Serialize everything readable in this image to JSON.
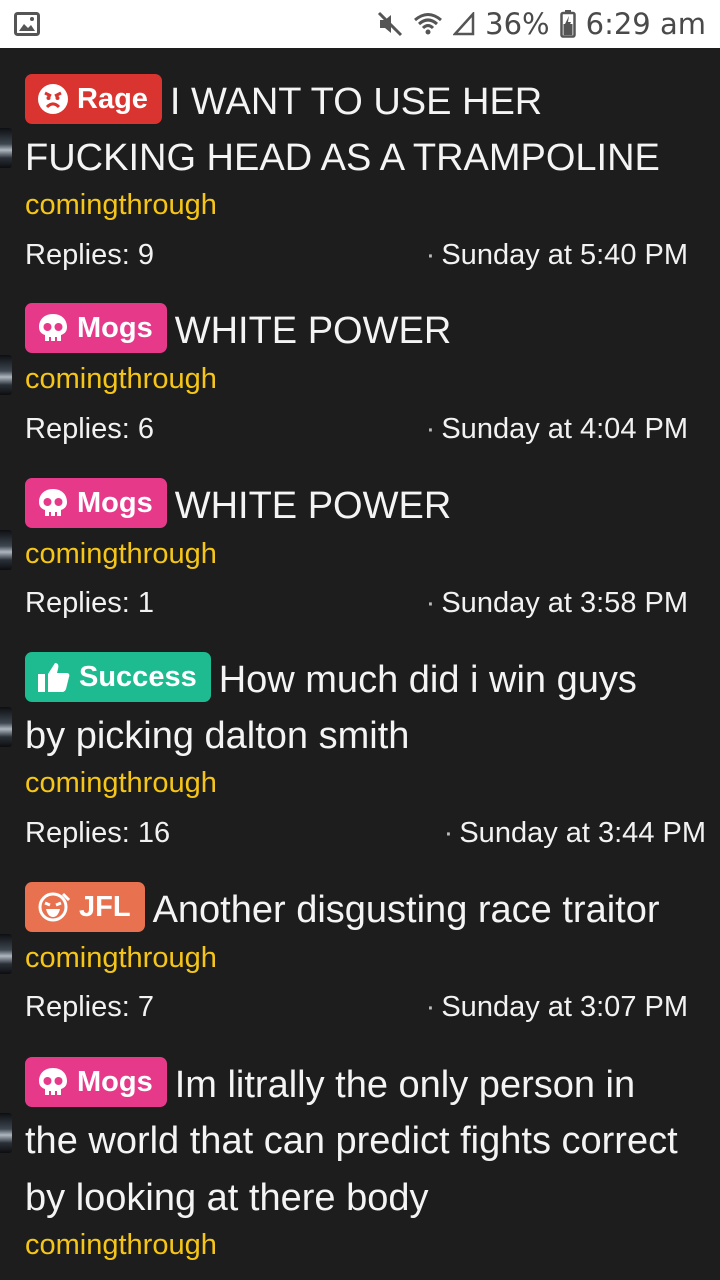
{
  "statusbar": {
    "battery": "36%",
    "time": "6:29 am"
  },
  "colors": {
    "background": "#1d1d1d",
    "author": "#f5c518",
    "rage": "#d9342f",
    "mogs": "#e6398a",
    "success": "#1dbb8f",
    "jfl": "#e8714f"
  },
  "threads": [
    {
      "prefix": "Rage",
      "prefix_icon": "angry-face-icon",
      "title_lines": [
        "I WANT TO USE HER",
        "FUCKING HEAD AS A TRAMPOLINE"
      ],
      "author": "comingthrough",
      "replies": "Replies: 9",
      "date": "Sunday at 5:40 PM"
    },
    {
      "prefix": "Mogs",
      "prefix_icon": "skull-icon",
      "title_lines": [
        "WHITE POWER"
      ],
      "author": "comingthrough",
      "replies": "Replies: 6",
      "date": "Sunday at 4:04 PM"
    },
    {
      "prefix": "Mogs",
      "prefix_icon": "skull-icon",
      "title_lines": [
        "WHITE POWER"
      ],
      "author": "comingthrough",
      "replies": "Replies: 1",
      "date": "Sunday at 3:58 PM"
    },
    {
      "prefix": "Success",
      "prefix_icon": "thumbs-up-icon",
      "title_lines": [
        "How much did i win guys",
        "by picking dalton smith"
      ],
      "author": "comingthrough",
      "replies": "Replies: 16",
      "date": "Sunday at 3:44 PM"
    },
    {
      "prefix": "JFL",
      "prefix_icon": "laughing-face-icon",
      "title_lines": [
        "Another disgusting race traitor"
      ],
      "author": "comingthrough",
      "replies": "Replies: 7",
      "date": "Sunday at 3:07 PM"
    },
    {
      "prefix": "Mogs",
      "prefix_icon": "skull-icon",
      "title_lines": [
        "Im litrally the only person in",
        "the world that can predict fights correct",
        "by looking at there body"
      ],
      "author": "comingthrough",
      "replies": "",
      "date": ""
    }
  ]
}
